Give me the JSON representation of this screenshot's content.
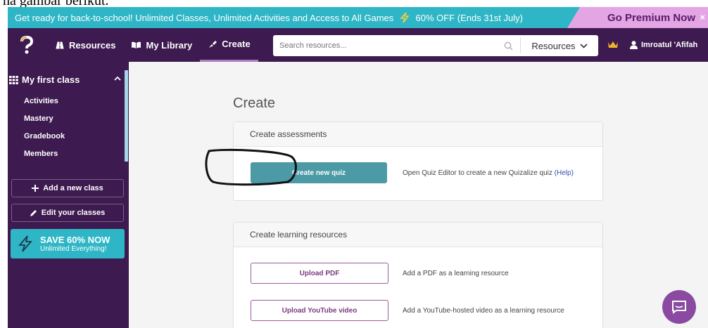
{
  "caption": "na gambar berikut.",
  "promo": {
    "text": "Get ready for back-to-school! Unlimited Classes, Unlimited Activities and Access to All Games",
    "offer": "60% OFF (Ends 31st July)",
    "premium_label": "Go Premium Now",
    "close": "×"
  },
  "nav": {
    "resources": "Resources",
    "library": "My Library",
    "create": "Create",
    "search_placeholder": "Search resources...",
    "resources_dropdown": "Resources",
    "user_name": "Imroatul 'Afifah"
  },
  "sidebar": {
    "class_name": "My first class",
    "links": [
      "Activities",
      "Mastery",
      "Gradebook",
      "Members"
    ],
    "add_class": "Add a new class",
    "edit_classes": "Edit your classes",
    "save_title": "SAVE 60% NOW",
    "save_sub": "Unlimited Everything!"
  },
  "main": {
    "title": "Create",
    "assessments": {
      "header": "Create assessments",
      "button": "Create new quiz",
      "desc": "Open Quiz Editor to create a new Quizalize quiz",
      "help": "(Help)"
    },
    "learning": {
      "header": "Create learning resources",
      "items": [
        {
          "button": "Upload PDF",
          "desc": "Add a PDF as a learning resource"
        },
        {
          "button": "Upload YouTube video",
          "desc": "Add a YouTube-hosted video as a learning resource"
        }
      ]
    }
  },
  "colors": {
    "promo_bg": "#2fb6c6",
    "nav_bg": "#3d1a4f",
    "premium_bg": "#e3a5e3",
    "primary_button": "#4b9aa6",
    "outline_button": "#9a5a9a"
  },
  "icons": [
    "logo-icon",
    "resources-icon",
    "library-icon",
    "create-icon",
    "search-icon",
    "chevron-down-icon",
    "crown-icon",
    "user-icon",
    "grid-icon",
    "plus-icon",
    "pencil-icon",
    "lightning-icon",
    "chat-icon"
  ]
}
